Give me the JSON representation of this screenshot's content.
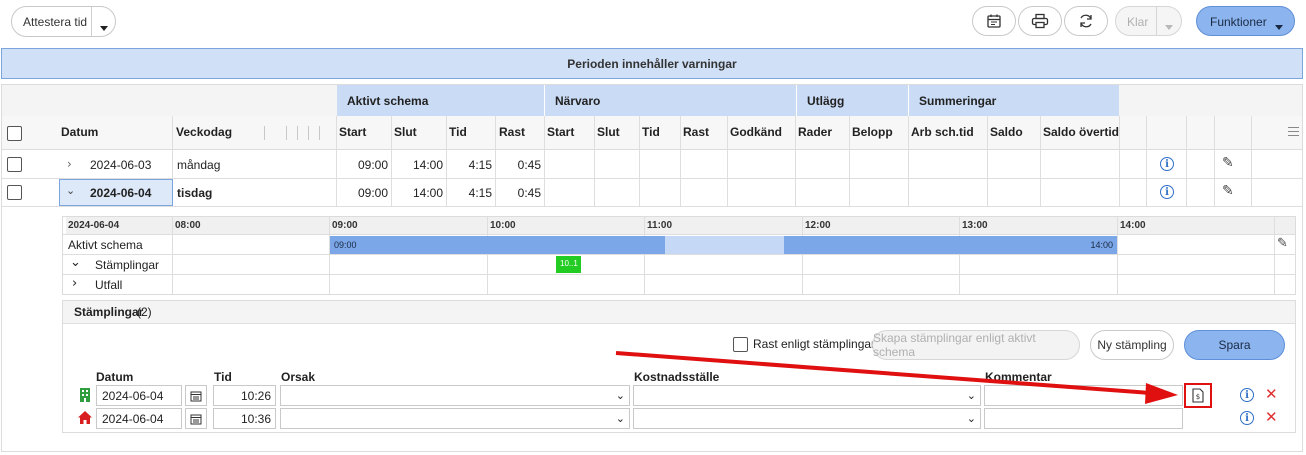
{
  "toolbar": {
    "attest_label": "Attestera tid",
    "klar_label": "Klar",
    "funktioner_label": "Funktioner",
    "icons": [
      "calendar-icon",
      "print-icon",
      "refresh-icon"
    ]
  },
  "warning": "Perioden innehåller varningar",
  "groups": {
    "aktivt_schema": "Aktivt schema",
    "narvaro": "Närvaro",
    "utlagg": "Utlägg",
    "summeringar": "Summeringar"
  },
  "columns": {
    "datum": "Datum",
    "veckodag": "Veckodag",
    "as_start": "Start",
    "as_slut": "Slut",
    "as_tid": "Tid",
    "as_rast": "Rast",
    "n_start": "Start",
    "n_slut": "Slut",
    "n_tid": "Tid",
    "n_rast": "Rast",
    "n_godkand": "Godkänd",
    "u_rader": "Rader",
    "u_belopp": "Belopp",
    "s_arb": "Arb sch.tid",
    "s_saldo": "Saldo",
    "s_saldo_overtid": "Saldo övertid"
  },
  "rows": [
    {
      "datum": "2024-06-03",
      "veckodag": "måndag",
      "start": "09:00",
      "slut": "14:00",
      "tid": "4:15",
      "rast": "0:45"
    },
    {
      "datum": "2024-06-04",
      "veckodag": "tisdag",
      "start": "09:00",
      "slut": "14:00",
      "tid": "4:15",
      "rast": "0:45"
    }
  ],
  "timeline": {
    "date": "2024-06-04",
    "hours": [
      "08:00",
      "09:00",
      "10:00",
      "11:00",
      "12:00",
      "13:00",
      "14:00"
    ],
    "rows": [
      "Aktivt schema",
      "Stämplingar",
      "Utfall"
    ],
    "bar_start": "09:00",
    "bar_end": "14:00",
    "stamp_label": "10..1"
  },
  "stamplingar": {
    "title": "Stämplingar",
    "count": "(2)",
    "rast_label": "Rast enligt stämplingar",
    "skapa_label": "Skapa stämplingar enligt aktivt schema",
    "ny_label": "Ny stämpling",
    "spara_label": "Spara",
    "headers": {
      "datum": "Datum",
      "tid": "Tid",
      "orsak": "Orsak",
      "kostnad": "Kostnadsställe",
      "kommentar": "Kommentar"
    },
    "rows": [
      {
        "icon": "building-icon",
        "datum": "2024-06-04",
        "tid": "10:26"
      },
      {
        "icon": "home-icon",
        "datum": "2024-06-04",
        "tid": "10:36"
      }
    ]
  },
  "colors": {
    "accent": "#7ba7e8",
    "header_blue": "#c9dbf5",
    "warning_bg": "#cfe0f7",
    "arrow": "#e01010",
    "stamp_green": "#22cc22"
  }
}
